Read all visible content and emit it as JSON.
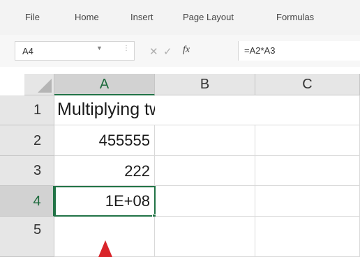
{
  "menu": {
    "items": [
      "File",
      "Home",
      "Insert",
      "Page Layout",
      "Formulas"
    ]
  },
  "formula_bar": {
    "name_box": "A4",
    "formula": "=A2*A3",
    "icons": [
      "dropdown-arrow-icon",
      "cancel-icon",
      "enter-icon",
      "insert-function-icon"
    ]
  },
  "grid": {
    "columns": [
      "A",
      "B",
      "C"
    ],
    "selected_column": "A",
    "rows": [
      {
        "label": "1",
        "A": "Multiplying two numbers",
        "B": "",
        "C": ""
      },
      {
        "label": "2",
        "A": "455555",
        "B": "",
        "C": ""
      },
      {
        "label": "3",
        "A": "222",
        "B": "",
        "C": ""
      },
      {
        "label": "4",
        "A": "1E+08",
        "B": "",
        "C": ""
      },
      {
        "label": "5",
        "A": "",
        "B": "",
        "C": ""
      }
    ],
    "active_cell": "A4",
    "colors": {
      "selection": "#217346",
      "annotation_arrow": "#d9242a"
    }
  },
  "annotation": {
    "icon": "red-pointer-arrow-icon"
  }
}
